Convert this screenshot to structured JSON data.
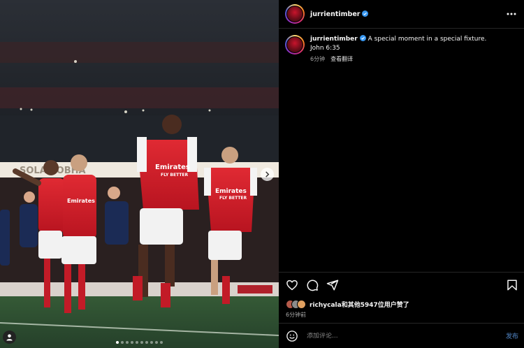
{
  "post": {
    "username": "jurrientimber",
    "caption_text": "A special moment in a special fixture.",
    "caption_line2": "John 6:35",
    "time_ago": "6分钟",
    "see_translation": "查看翻译",
    "liked_by_user": "richycala",
    "liked_by_suffix": "和其他5947位用户赞了",
    "time_ago_full": "6分钟前"
  },
  "comment": {
    "placeholder": "添加评论...",
    "post_label": "发布"
  },
  "image": {
    "sponsor_text": "Emirates",
    "sponsor_sub": "FLY BETTER",
    "stadium_banner": "SOLA  SOBHA",
    "carousel_count": 10,
    "carousel_active": 1
  },
  "colors": {
    "accent_link": "#3a5f8c",
    "verified": "#3897f0",
    "kit_red": "#d61d2a"
  },
  "icons": [
    "verified-icon",
    "more-icon",
    "heart-icon",
    "comment-icon",
    "share-icon",
    "bookmark-icon",
    "emoji-icon",
    "chevron-right-icon",
    "user-tag-icon"
  ]
}
